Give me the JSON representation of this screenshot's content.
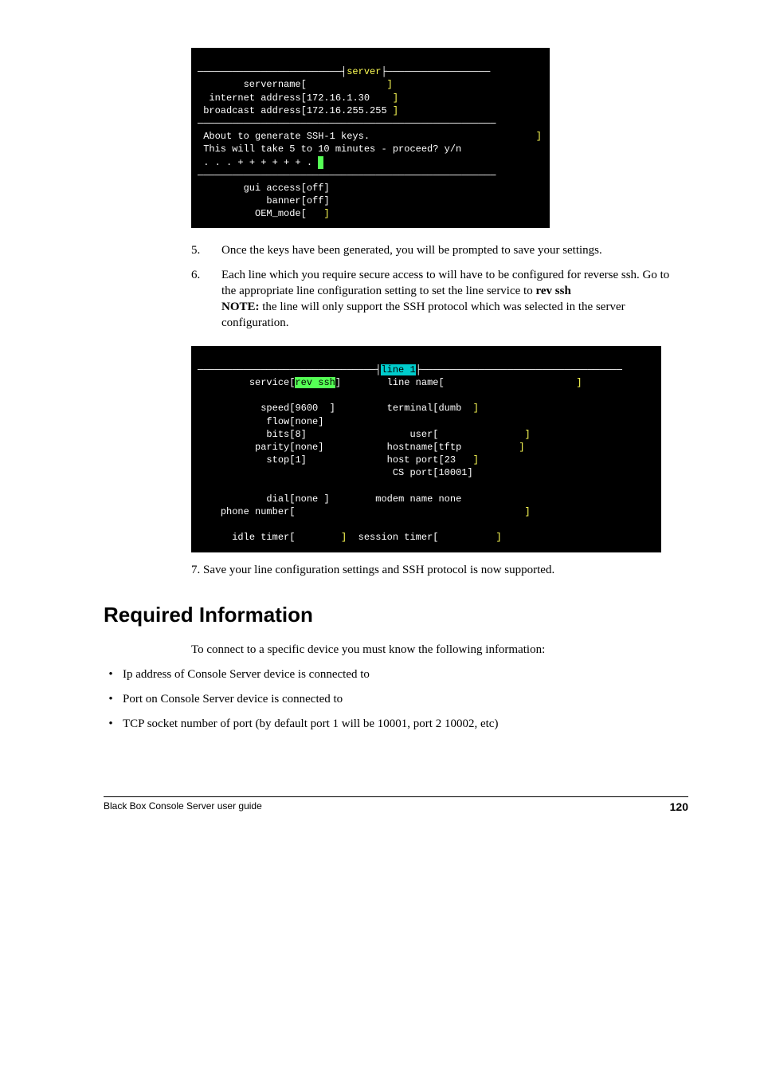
{
  "terminal1": {
    "title": "server",
    "line1_label": "servername",
    "line1_val": "",
    "line2_label": "internet address",
    "line2_val": "172.16.1.30",
    "line3_label": "broadcast address",
    "line3_val": "172.16.255.255",
    "msg1": "About to generate SSH-1 keys.",
    "msg2": "This will take 5 to 10 minutes - proceed? y/n",
    "progress": ". . . + + + + + + .",
    "opt1_label": "gui access",
    "opt1_val": "off",
    "opt2_label": "banner",
    "opt2_val": "off",
    "opt3_label": "OEM_mode",
    "opt3_val": ""
  },
  "steps": {
    "s5_num": "5.",
    "s5_text": "Once the keys have been generated, you will be prompted to save your settings.",
    "s6_num": "6.",
    "s6_text_a": "Each line which you require secure access to will have to be configured for reverse ssh. Go to the appropriate line configuration setting to set the line service to ",
    "s6_rev": "rev ssh",
    "s6_note_label": "NOTE:",
    "s6_note_text": " the line will only support the SSH protocol which was selected in the server configuration."
  },
  "terminal2": {
    "title": "line 1",
    "l_service": "service",
    "v_service": "rev ssh",
    "l_linename": "line name",
    "v_linename": "",
    "l_speed": "speed",
    "v_speed": "9600",
    "l_terminal": "terminal",
    "v_terminal": "dumb",
    "l_flow": "flow",
    "v_flow": "none",
    "l_bits": "bits",
    "v_bits": "8",
    "l_user": "user",
    "v_user": "",
    "l_parity": "parity",
    "v_parity": "none",
    "l_hostname": "hostname",
    "v_hostname": "tftp",
    "l_stop": "stop",
    "v_stop": "1",
    "l_hostport": "host port",
    "v_hostport": "23",
    "l_csport": "CS port",
    "v_csport": "10001",
    "l_dial": "dial",
    "v_dial": "none",
    "l_modemname": "modem name",
    "v_modemname": "none",
    "l_phone": "phone number",
    "v_phone": "",
    "l_idle": "idle timer",
    "v_idle": "",
    "l_session": "session timer",
    "v_session": ""
  },
  "save_line": "7. Save your line configuration settings and SSH protocol is now supported.",
  "section_head": "Required Information",
  "intro": "To connect to a specific device you must know the following information:",
  "bullets": {
    "b1": "Ip address of Console Server device is connected to",
    "b2": "Port on Console Server device is connected to",
    "b3": "TCP socket number of port (by default port 1 will be 10001, port 2 10002, etc)"
  },
  "footer": {
    "left": "Black Box Console Server user guide",
    "page": "120"
  }
}
